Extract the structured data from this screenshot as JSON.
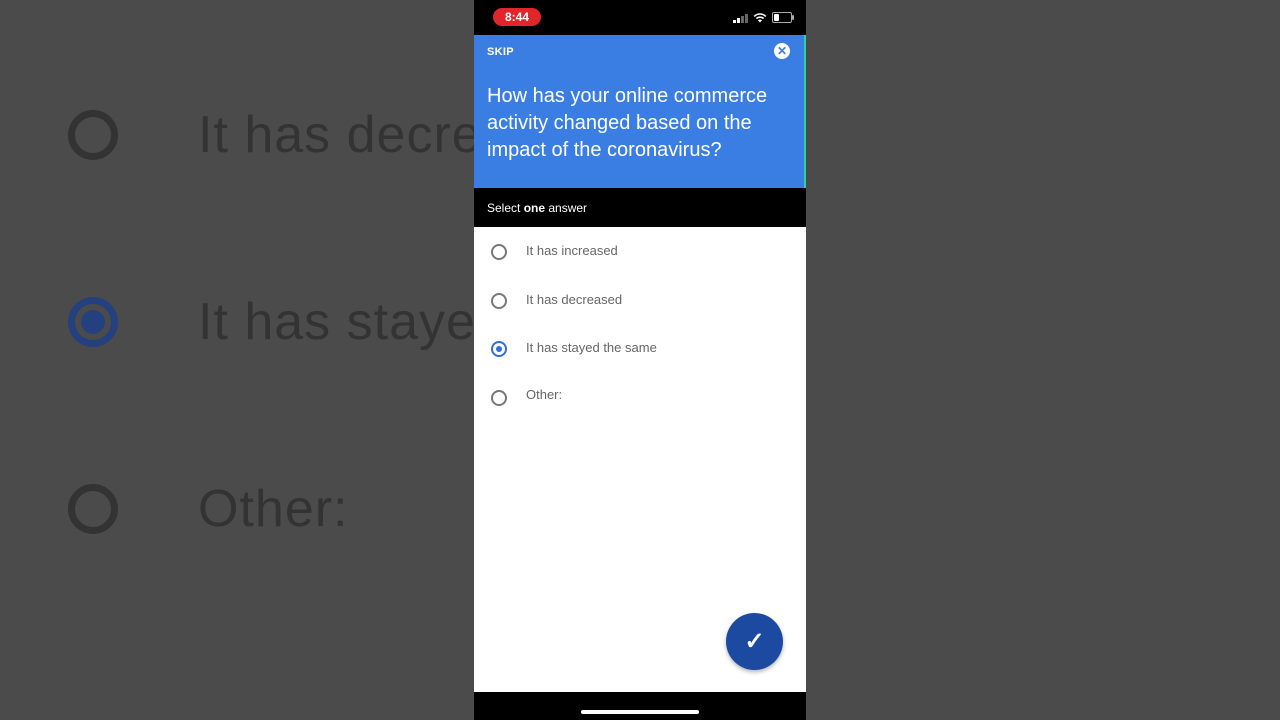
{
  "background": {
    "items": [
      {
        "label": "It has decreased",
        "selected": false
      },
      {
        "label": "It has stayed the same",
        "selected": true
      },
      {
        "label": "Other:",
        "selected": false
      }
    ]
  },
  "status_bar": {
    "time": "8:44"
  },
  "header": {
    "skip_label": "SKIP",
    "close_icon": "close-icon",
    "question": "How has your online commerce activity changed based on the impact of the coronavirus?"
  },
  "instruction": {
    "prefix": "Select ",
    "emphasis": "one",
    "suffix": " answer"
  },
  "options": [
    {
      "label": "It has increased",
      "selected": false
    },
    {
      "label": "It has decreased",
      "selected": false
    },
    {
      "label": "It has stayed the same",
      "selected": true
    },
    {
      "label": "Other:",
      "selected": false
    }
  ],
  "submit": {
    "icon": "check-icon",
    "glyph": "✓"
  },
  "colors": {
    "header_bg": "#3b7ee3",
    "accent": "#2f6fd6",
    "fab": "#1d4aa1",
    "time_pill": "#e0262b"
  }
}
